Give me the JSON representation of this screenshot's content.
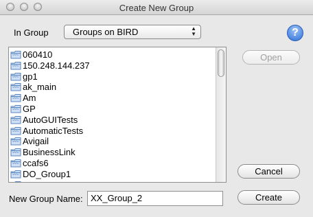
{
  "window": {
    "title": "Create New Group"
  },
  "in_group": {
    "label": "In Group",
    "selected": "Groups on BIRD"
  },
  "help": {
    "glyph": "?"
  },
  "groups": [
    "060410",
    "150.248.144.237",
    "gp1",
    "ak_main",
    "Am",
    "GP",
    "AutoGUITests",
    "AutomaticTests",
    "Avigail",
    "BusinessLink",
    "ccafs6",
    "DO_Group1",
    ""
  ],
  "buttons": {
    "open": "Open",
    "cancel": "Cancel",
    "create": "Create"
  },
  "new_group": {
    "label": "New Group Name:",
    "value": "XX_Group_2"
  },
  "icons": {
    "group": "folder-icon",
    "help": "help-icon"
  }
}
